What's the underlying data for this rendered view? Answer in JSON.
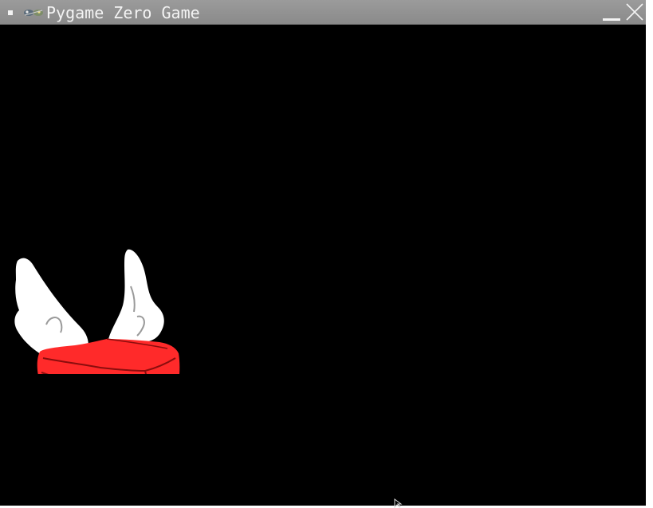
{
  "window": {
    "title": "Pygame Zero Game",
    "menu_icon": "square-menu-icon",
    "app_icon": "pygame-snake-icon",
    "minimize_icon": "minimize-icon",
    "close_icon": "close-icon"
  },
  "game": {
    "background_color": "#000000",
    "sprite": {
      "name": "flying-brick-with-wings",
      "brick_color": "#ff2a2a",
      "wing_color": "#ffffff"
    },
    "cursor_icon": "mouse-pointer-icon"
  }
}
